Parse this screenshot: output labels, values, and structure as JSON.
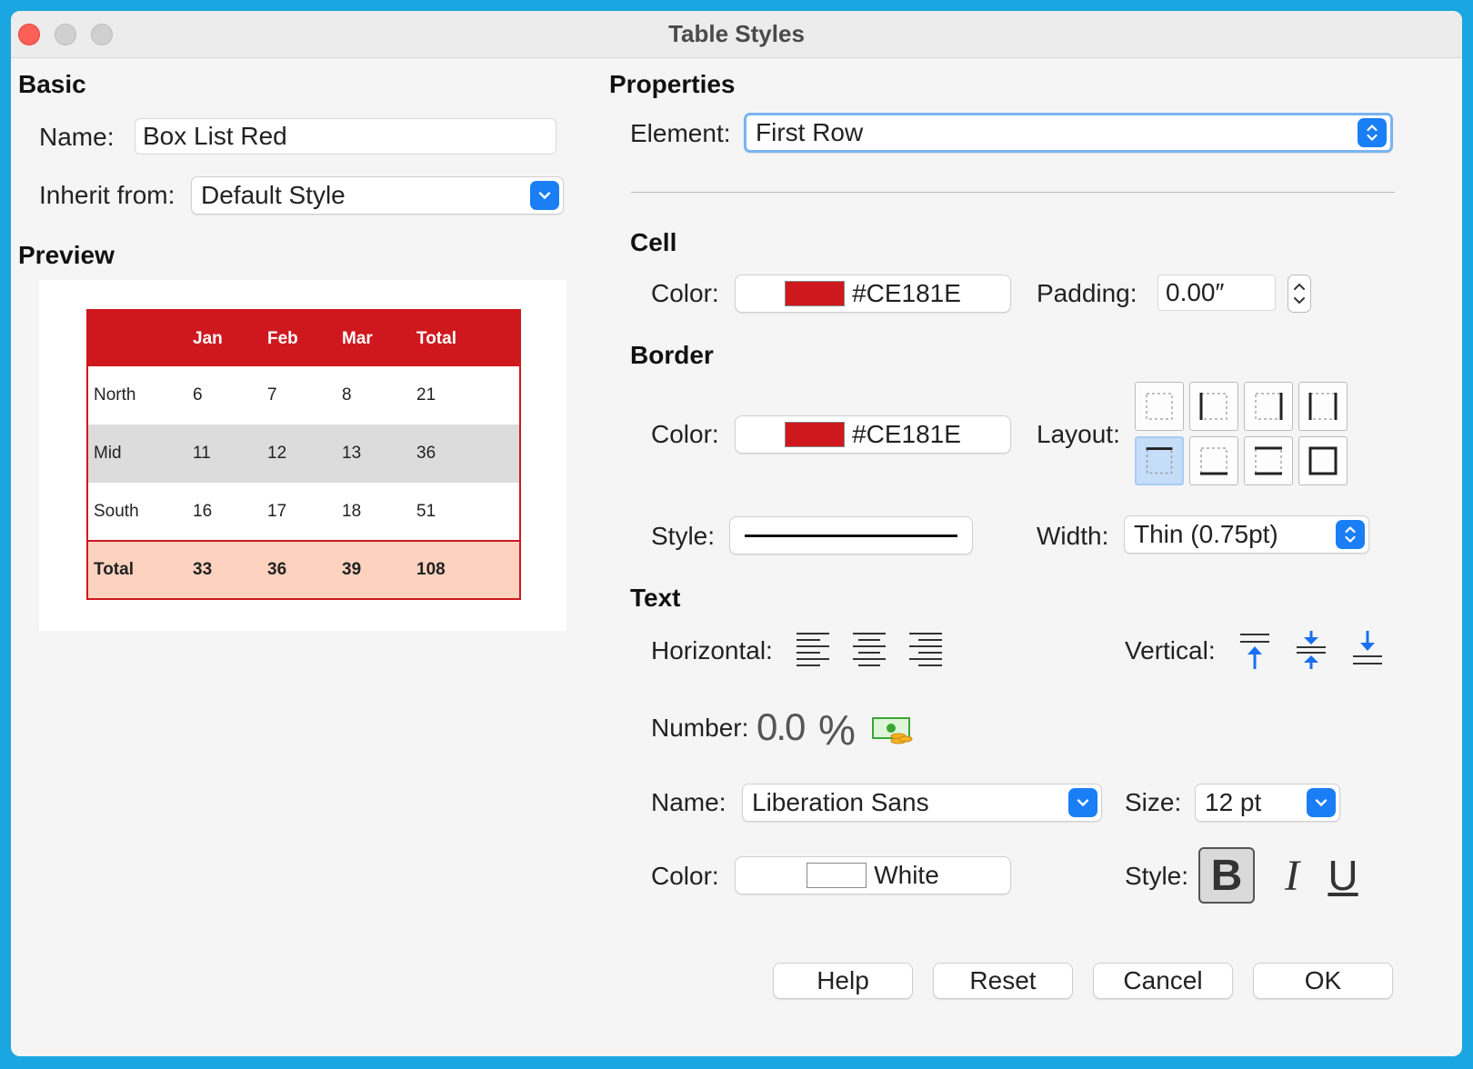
{
  "window": {
    "title": "Table Styles"
  },
  "basic": {
    "heading": "Basic",
    "name_label": "Name:",
    "name_value": "Box List Red",
    "inherit_label": "Inherit from:",
    "inherit_value": "Default Style"
  },
  "preview": {
    "heading": "Preview",
    "header": [
      "",
      "Jan",
      "Feb",
      "Mar",
      "Total"
    ],
    "rows": [
      [
        "North",
        "6",
        "7",
        "8",
        "21"
      ],
      [
        "Mid",
        "11",
        "12",
        "13",
        "36"
      ],
      [
        "South",
        "16",
        "17",
        "18",
        "51"
      ]
    ],
    "total_row": [
      "Total",
      "33",
      "36",
      "39",
      "108"
    ],
    "colors": {
      "accent": "#CE181E",
      "alt_row": "#DCDCDC",
      "total_row": "#FDD3C0"
    }
  },
  "properties": {
    "heading": "Properties",
    "element_label": "Element:",
    "element_value": "First Row"
  },
  "cell": {
    "heading": "Cell",
    "color_label": "Color:",
    "color_value": "#CE181E",
    "padding_label": "Padding:",
    "padding_value": "0.00″"
  },
  "border": {
    "heading": "Border",
    "color_label": "Color:",
    "color_value": "#CE181E",
    "layout_label": "Layout:",
    "layout_options": [
      "none",
      "left-right-inner",
      "left-right",
      "all-vertical",
      "top",
      "bottom",
      "top-bottom",
      "outer-box"
    ],
    "layout_selected": "top",
    "style_label": "Style:",
    "width_label": "Width:",
    "width_value": "Thin (0.75pt)"
  },
  "text": {
    "heading": "Text",
    "horizontal_label": "Horizontal:",
    "vertical_label": "Vertical:",
    "number_label": "Number:",
    "number_decimal_glyph": "0.0",
    "number_percent_glyph": "%",
    "font_name_label": "Name:",
    "font_name_value": "Liberation Sans",
    "size_label": "Size:",
    "size_value": "12 pt",
    "color_label": "Color:",
    "color_value": "White",
    "style_label": "Style:",
    "bold_glyph": "B",
    "italic_glyph": "I",
    "underline_glyph": "U"
  },
  "buttons": {
    "help": "Help",
    "reset": "Reset",
    "cancel": "Cancel",
    "ok": "OK"
  }
}
